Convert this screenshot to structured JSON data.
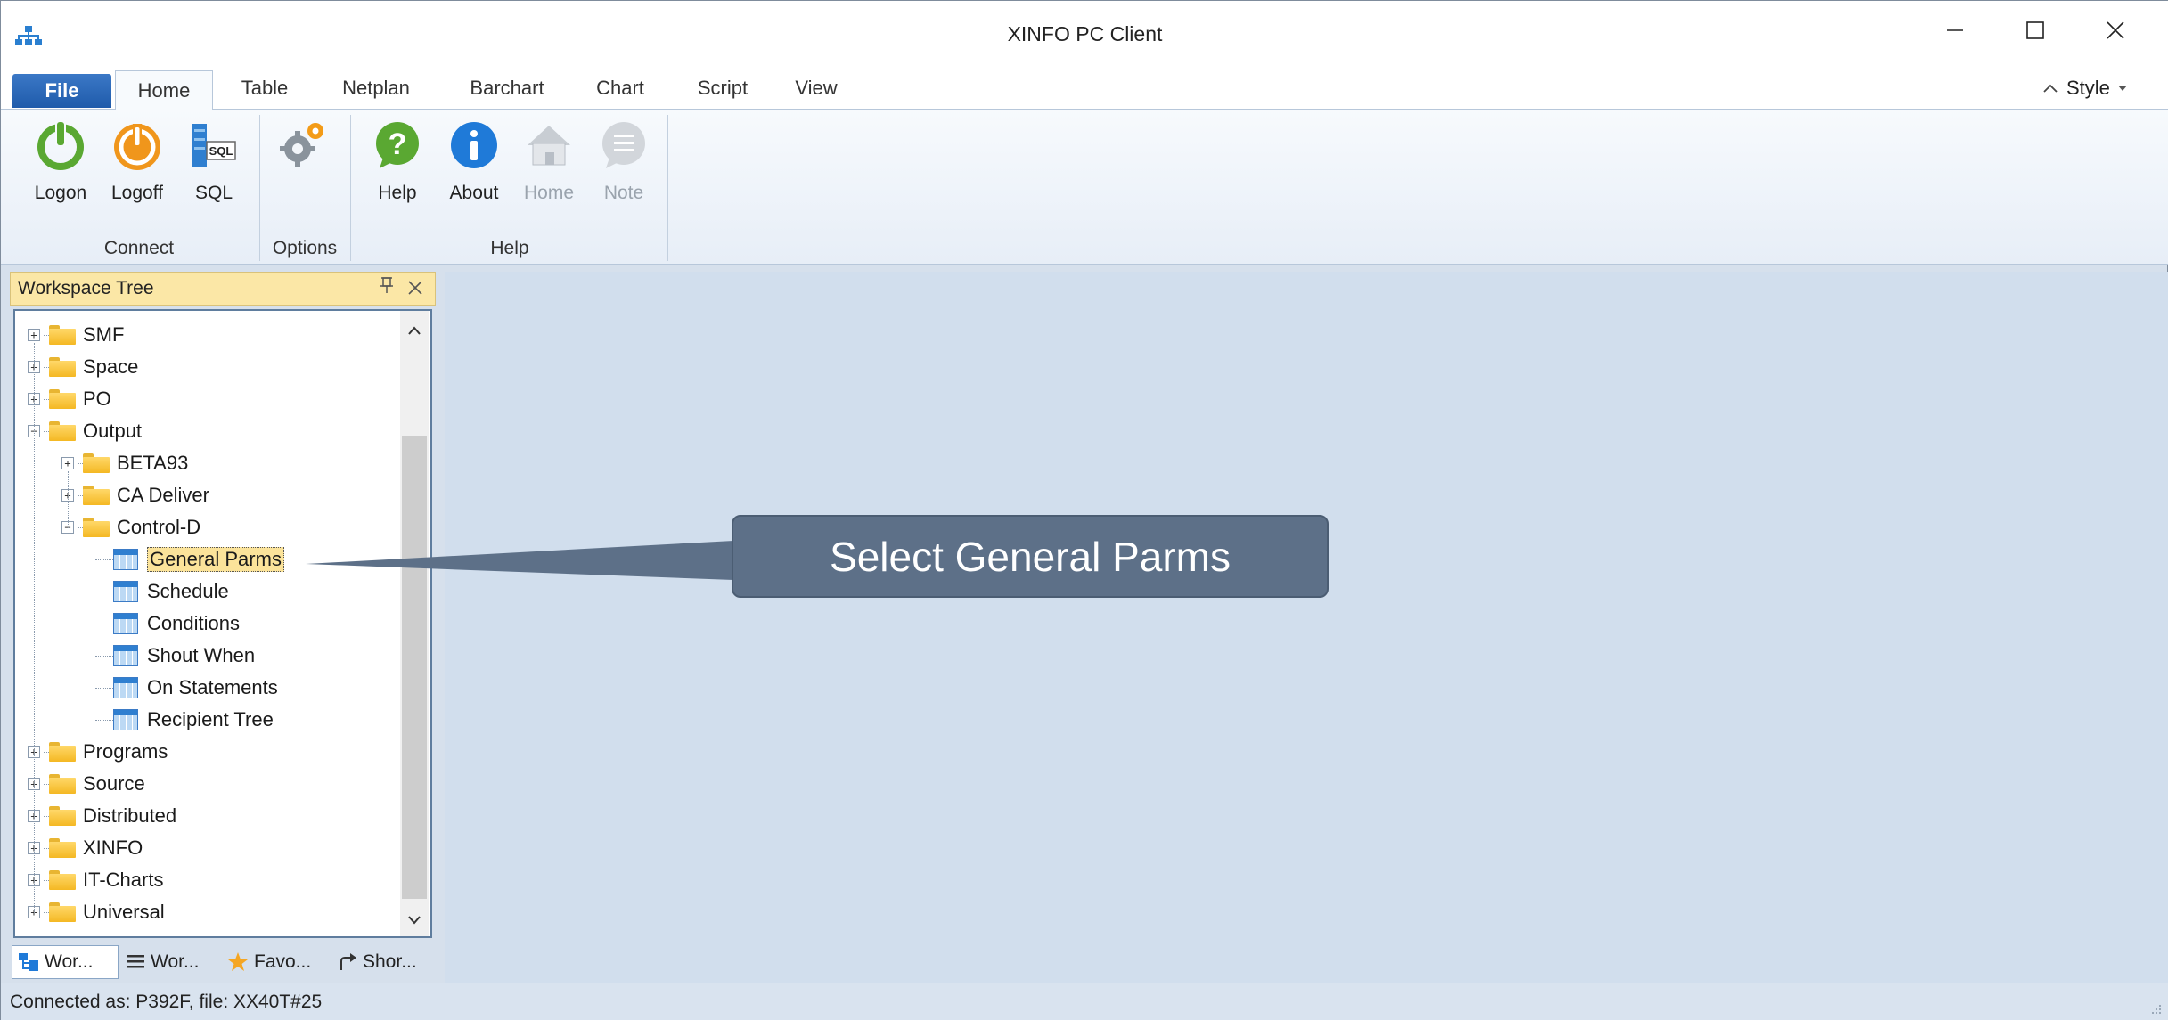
{
  "window": {
    "title": "XINFO PC Client"
  },
  "ribbon_tabs": [
    "File",
    "Home",
    "Table",
    "Netplan",
    "Barchart",
    "Chart",
    "Script",
    "View"
  ],
  "style_menu": {
    "label": "Style"
  },
  "ribbon": {
    "buttons": {
      "logon": "Logon",
      "logoff": "Logoff",
      "sql": "SQL",
      "help": "Help",
      "about": "About",
      "home": "Home",
      "note": "Note"
    },
    "sql_icon_text": "SQL",
    "groups": {
      "connect": "Connect",
      "options": "Options",
      "help": "Help"
    }
  },
  "workspace": {
    "title": "Workspace Tree",
    "tree": [
      {
        "label": "SMF",
        "level": 0,
        "type": "folder",
        "expanded": false
      },
      {
        "label": "Space",
        "level": 0,
        "type": "folder",
        "expanded": false
      },
      {
        "label": "PO",
        "level": 0,
        "type": "folder",
        "expanded": false
      },
      {
        "label": "Output",
        "level": 0,
        "type": "folder",
        "expanded": true
      },
      {
        "label": "BETA93",
        "level": 1,
        "type": "folder",
        "expanded": false
      },
      {
        "label": "CA Deliver",
        "level": 1,
        "type": "folder",
        "expanded": false
      },
      {
        "label": "Control-D",
        "level": 1,
        "type": "folder",
        "expanded": true
      },
      {
        "label": "General Parms",
        "level": 2,
        "type": "table",
        "selected": true
      },
      {
        "label": "Schedule",
        "level": 2,
        "type": "table"
      },
      {
        "label": "Conditions",
        "level": 2,
        "type": "table"
      },
      {
        "label": "Shout When",
        "level": 2,
        "type": "table"
      },
      {
        "label": "On Statements",
        "level": 2,
        "type": "table"
      },
      {
        "label": "Recipient Tree",
        "level": 2,
        "type": "table"
      },
      {
        "label": "Programs",
        "level": 0,
        "type": "folder",
        "expanded": false
      },
      {
        "label": "Source",
        "level": 0,
        "type": "folder",
        "expanded": false
      },
      {
        "label": "Distributed",
        "level": 0,
        "type": "folder",
        "expanded": false
      },
      {
        "label": "XINFO",
        "level": 0,
        "type": "folder",
        "expanded": false
      },
      {
        "label": "IT-Charts",
        "level": 0,
        "type": "folder",
        "expanded": false
      },
      {
        "label": "Universal",
        "level": 0,
        "type": "folder",
        "expanded": false
      }
    ],
    "panel_tabs": [
      "Wor...",
      "Wor...",
      "Favo...",
      "Shor..."
    ]
  },
  "callout": {
    "text": "Select General Parms"
  },
  "status": {
    "text": "Connected as: P392F, file: XX40T#25"
  },
  "colors": {
    "accent": "#1f5bab",
    "callout_bg": "#5d7088",
    "selection": "#fbe39a",
    "header": "#fbe7a6"
  }
}
